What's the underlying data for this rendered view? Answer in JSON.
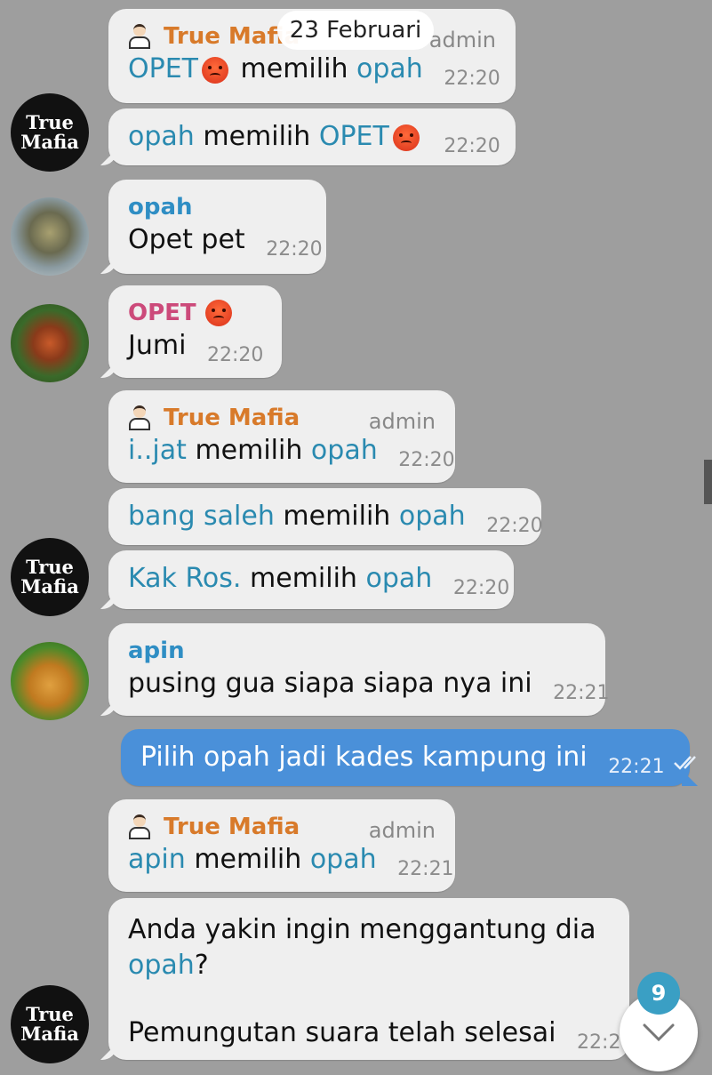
{
  "date_label": "23 Februari",
  "unread_count": "9",
  "messages": [
    {
      "sender": "True Mafia",
      "role": "admin",
      "parts": [
        "OPET",
        "memilih",
        "opah"
      ],
      "time": "22:20"
    },
    {
      "parts": [
        "opah",
        "memilih",
        "OPET"
      ],
      "time": "22:20"
    },
    {
      "sender": "opah",
      "text": "Opet pet",
      "time": "22:20"
    },
    {
      "sender": "OPET",
      "text": "Jumi",
      "time": "22:20"
    },
    {
      "sender": "True Mafia",
      "role": "admin",
      "parts": [
        "i..jat",
        "memilih",
        "opah"
      ],
      "time": "22:20"
    },
    {
      "parts": [
        "bang saleh",
        "memilih",
        "opah"
      ],
      "time": "22:20"
    },
    {
      "parts": [
        "Kak Ros.",
        "memilih",
        "opah"
      ],
      "time": "22:20"
    },
    {
      "sender": "apin",
      "text": "pusing gua siapa siapa nya ini",
      "time": "22:21"
    },
    {
      "text": "Pilih opah jadi kades kampung ini",
      "time": "22:21",
      "outgoing": true
    },
    {
      "sender": "True Mafia",
      "role": "admin",
      "parts": [
        "apin",
        "memilih",
        "opah"
      ],
      "time": "22:21"
    },
    {
      "line1": "Anda yakin ingin menggantung dia",
      "name": "opah",
      "q": "?",
      "line3": "Pemungutan suara telah selesai",
      "time": "22:21"
    }
  ],
  "avatars": {
    "mafia_line1": "True",
    "mafia_line2": "Mafia"
  },
  "colors": {
    "background": "#9e9e9e",
    "bubble_incoming": "#efefef",
    "bubble_outgoing": "#4a90d9",
    "mention": "#2a8ab0",
    "sender_true_mafia": "#d87a2a",
    "sender_opah": "#2f8ec4",
    "sender_opet": "#cc4a7a",
    "sender_apin": "#2f8ec4",
    "badge": "#3a9fc4"
  },
  "icons": [
    "suit-person-icon",
    "angry-face-icon",
    "double-check-icon",
    "chevron-down-icon"
  ]
}
